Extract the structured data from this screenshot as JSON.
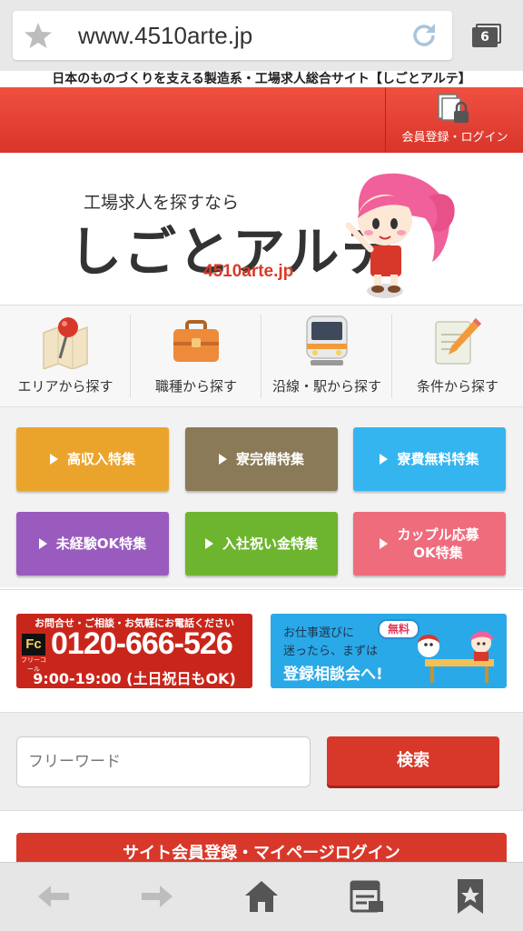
{
  "browser": {
    "url": "www.4510arte.jp",
    "tab_count": "6"
  },
  "header": {
    "tagline": "日本のものづくりを支える製造系・工場求人総合サイト【しごとアルテ】",
    "login_label": "会員登録・ログイン"
  },
  "logo": {
    "small": "工場求人を探すなら",
    "big": "しごとアルテ",
    "url": "4510arte.jp"
  },
  "nav": [
    {
      "label": "エリアから探す",
      "icon": "map-pin-icon"
    },
    {
      "label": "職種から探す",
      "icon": "briefcase-icon"
    },
    {
      "label": "沿線・駅から探す",
      "icon": "train-icon"
    },
    {
      "label": "条件から探す",
      "icon": "memo-pencil-icon"
    }
  ],
  "features": [
    {
      "label": "高収入特集",
      "color": "#eba42b"
    },
    {
      "label": "寮完備特集",
      "color": "#8b7a58"
    },
    {
      "label": "寮費無料特集",
      "color": "#35b5ef"
    },
    {
      "label": "未経験OK特集",
      "color": "#9a5bbf"
    },
    {
      "label": "入社祝い金特集",
      "color": "#6db52e"
    },
    {
      "label": "カップル応募\nOK特集",
      "color": "#ef6c7d"
    }
  ],
  "banners": {
    "phone_top": "お問合せ・ご相談・お気軽にお電話ください",
    "phone_logo": "Fc",
    "phone_free": "フリーコール",
    "phone_number": "0120-666-526",
    "phone_hours": "9:00-19:00 (土日祝日もOK)",
    "consult_line1": "お仕事選びに",
    "consult_line2": "迷ったら、まずは",
    "consult_line3": "登録相談会へ!",
    "consult_badge": "無料"
  },
  "search": {
    "placeholder": "フリーワード",
    "button": "検索"
  },
  "member_bar": "サイト会員登録・マイページログイン",
  "colors": {
    "accent_red": "#d8382a"
  }
}
